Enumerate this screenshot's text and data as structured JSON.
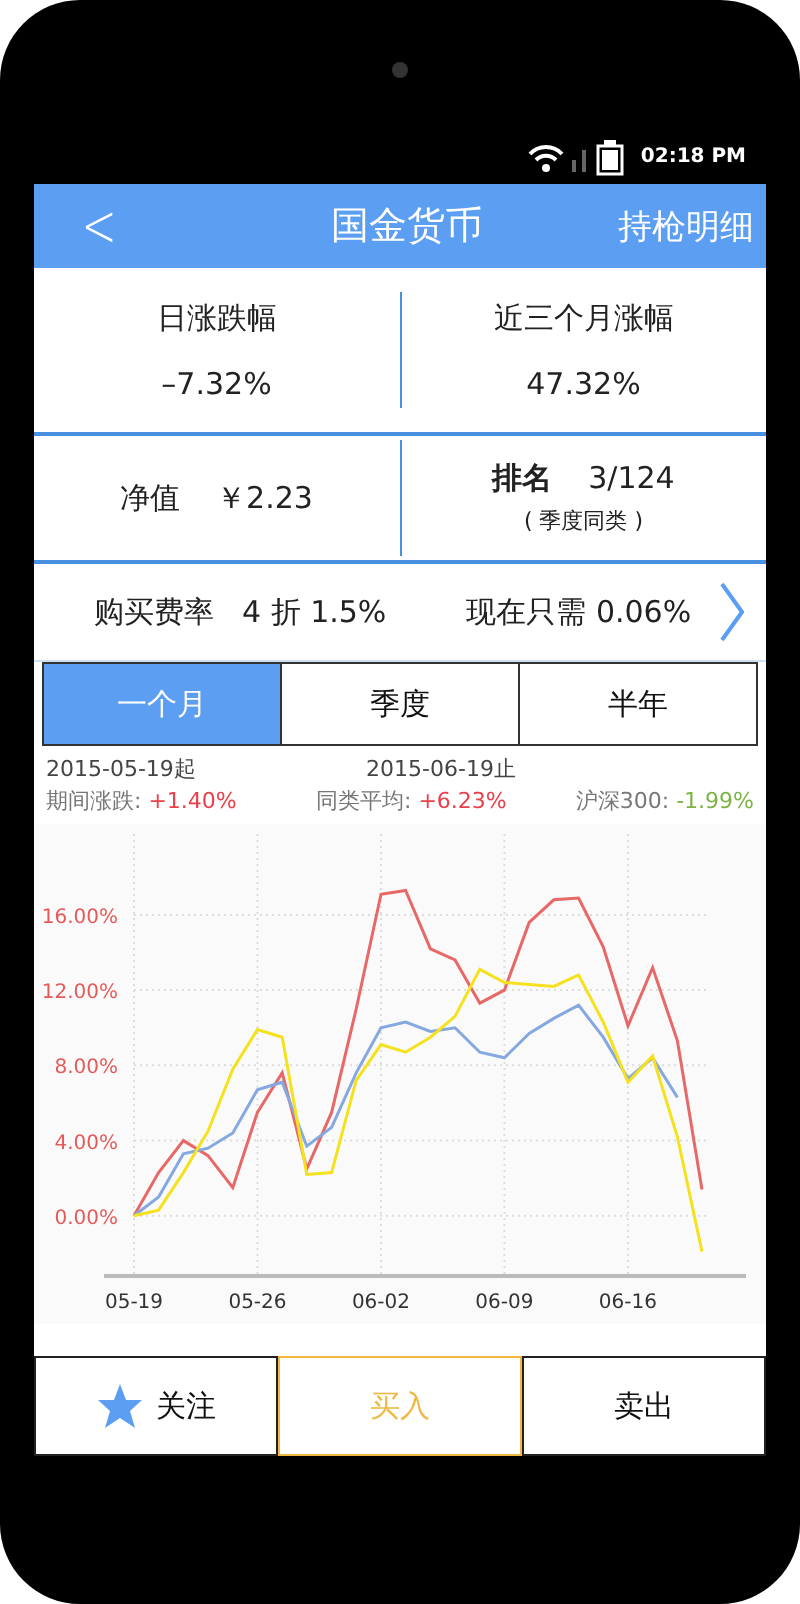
{
  "status_bar": {
    "time": "02:18 PM"
  },
  "header": {
    "back": "<",
    "title": "国金货币",
    "action": "持枪明细"
  },
  "summary": [
    {
      "label": "日涨跌幅",
      "value": "–7.32%"
    },
    {
      "label": "近三个月涨幅",
      "value": "47.32%"
    }
  ],
  "details": {
    "nav_label": "净值",
    "nav_value": "￥2.23",
    "rank_label": "排名",
    "rank_value": "3/124",
    "rank_note": "( 季度同类 )"
  },
  "fee": {
    "label": "购买费率",
    "discount": "4 折 1.5%",
    "now": "现在只需 0.06%"
  },
  "tabs": [
    {
      "label": "一个月",
      "selected": true
    },
    {
      "label": "季度",
      "selected": false
    },
    {
      "label": "半年",
      "selected": false
    }
  ],
  "period": {
    "start": "2015-05-19起",
    "end": "2015-06-19止"
  },
  "stats": [
    {
      "label": "期间涨跌:",
      "value": "+1.40%",
      "color": "#e8414b"
    },
    {
      "label": "同类平均:",
      "value": "+6.23%",
      "color": "#e8414b"
    },
    {
      "label": "沪深300:",
      "value": "-1.99%",
      "color": "#7cb342"
    }
  ],
  "chart_data": {
    "type": "line",
    "grid": true,
    "categories": [
      "05-19",
      null,
      null,
      null,
      null,
      "05-26",
      null,
      null,
      null,
      null,
      "06-02",
      null,
      null,
      null,
      null,
      "06-09",
      null,
      null,
      null,
      null,
      "06-16",
      null,
      null,
      null
    ],
    "ylim": [
      -3.2,
      20.3
    ],
    "yticks": [
      {
        "value": 0,
        "label": "0.00%"
      },
      {
        "value": 4,
        "label": "4.00%"
      },
      {
        "value": 8,
        "label": "8.00%"
      },
      {
        "value": 12,
        "label": "12.00%"
      },
      {
        "value": 16,
        "label": "16.00%"
      }
    ],
    "series": [
      {
        "color": "#e86868",
        "values": [
          0,
          2.3,
          4.0,
          3.2,
          1.5,
          5.5,
          7.6,
          2.5,
          5.5,
          11,
          17.1,
          17.3,
          14.2,
          13.6,
          11.3,
          12,
          15.6,
          16.8,
          16.9,
          14.3,
          10.1,
          13.2,
          9.3,
          1.4
        ]
      },
      {
        "color": "#85a8e0",
        "values": [
          0,
          1.0,
          3.3,
          3.6,
          4.4,
          6.7,
          7.1,
          3.7,
          4.7,
          7.6,
          10.0,
          10.3,
          9.8,
          10.0,
          8.7,
          8.4,
          9.7,
          10.5,
          11.2,
          9.5,
          7.3,
          8.4,
          6.3,
          null
        ]
      },
      {
        "color": "#f5e11e",
        "values": [
          0,
          0.3,
          2.3,
          4.5,
          7.8,
          9.9,
          9.5,
          2.2,
          2.3,
          7.2,
          9.1,
          8.7,
          9.5,
          10.6,
          13.1,
          12.4,
          12.3,
          12.2,
          12.8,
          10.3,
          7.1,
          8.5,
          4.2,
          -1.9
        ]
      }
    ]
  },
  "actions": [
    {
      "label": "关注",
      "kind": "follow",
      "selected": false
    },
    {
      "label": "买入",
      "kind": "plain",
      "selected": true
    },
    {
      "label": "卖出",
      "kind": "plain",
      "selected": false
    }
  ]
}
